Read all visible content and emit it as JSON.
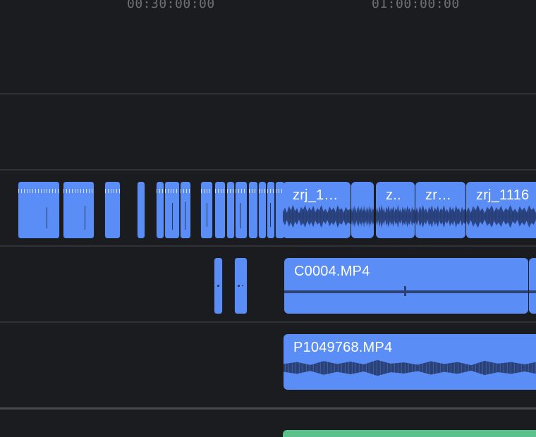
{
  "ruler": {
    "timecodes": [
      "00:30:00:00",
      "01:00:00:00"
    ]
  },
  "tracks": {
    "audio_a": {
      "clips": [
        {
          "name": "zrj_1…"
        },
        {
          "name": ""
        },
        {
          "name": "z.."
        },
        {
          "name": "zr…"
        },
        {
          "name": "zrj_1116"
        }
      ]
    },
    "audio_b": {
      "clips": [
        {
          "name": "C0004.MP4"
        }
      ]
    },
    "audio_c": {
      "clips": [
        {
          "name": "P1049768.MP4"
        }
      ]
    }
  },
  "colors": {
    "audio_clip": "#5a8df5",
    "waveform": "#2c4479",
    "video_clip": "#5cc08b",
    "background": "#1b1c20"
  }
}
